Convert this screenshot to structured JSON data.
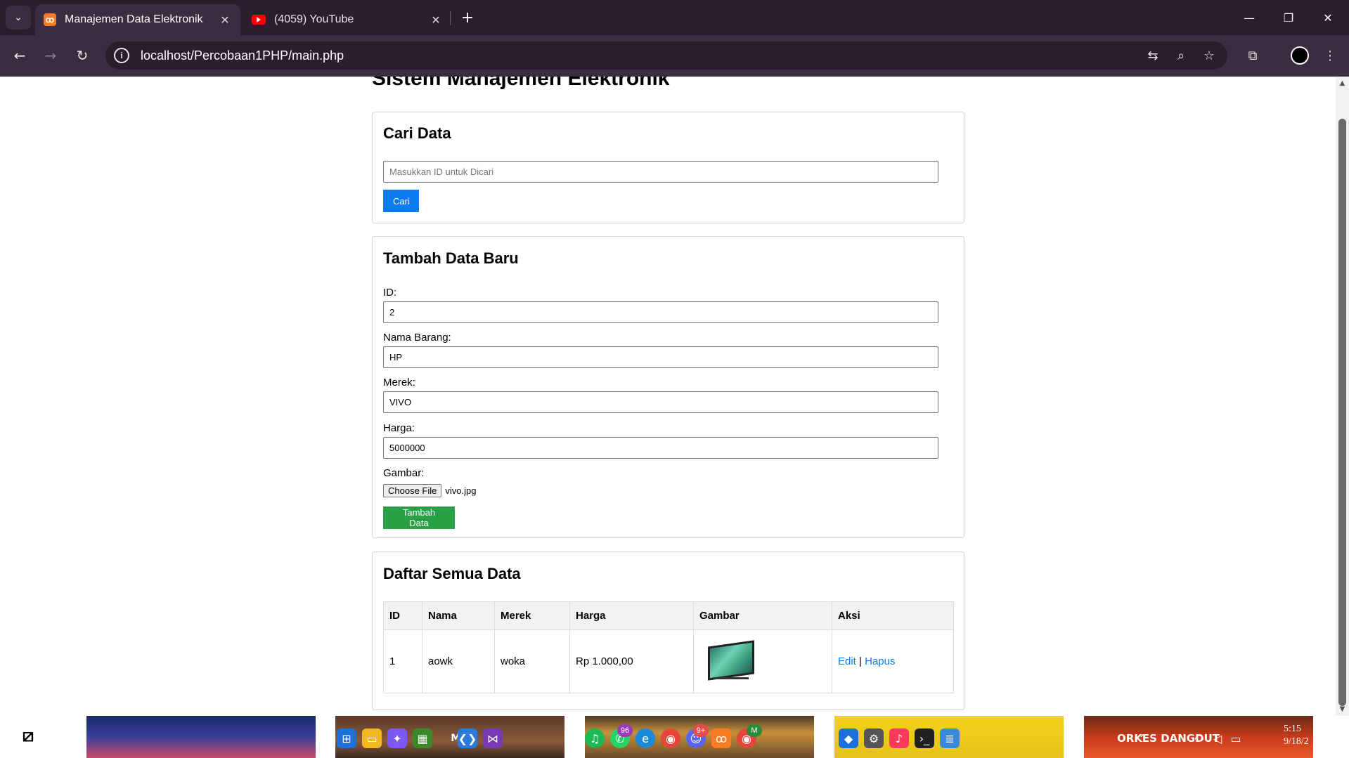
{
  "browser": {
    "tabs": [
      {
        "title": "Manajemen Data Elektronik",
        "favicon": "xampp-icon",
        "active": true
      },
      {
        "title": "(4059) YouTube",
        "favicon": "youtube-icon",
        "active": false
      }
    ],
    "url": "localhost/Percobaan1PHP/main.php"
  },
  "page": {
    "title": "Sistem Manajemen Elektronik",
    "search": {
      "heading": "Cari Data",
      "placeholder": "Masukkan ID untuk Dicari",
      "button_label": "Cari"
    },
    "add_form": {
      "heading": "Tambah Data Baru",
      "fields": {
        "id": {
          "label": "ID:",
          "value": "2"
        },
        "nama": {
          "label": "Nama Barang:",
          "value": "HP"
        },
        "merek": {
          "label": "Merek:",
          "value": "VIVO"
        },
        "harga": {
          "label": "Harga:",
          "value": "5000000"
        },
        "gambar": {
          "label": "Gambar:",
          "button": "Choose File",
          "file_name": "vivo.jpg"
        }
      },
      "submit_label": "Tambah Data"
    },
    "list": {
      "heading": "Daftar Semua Data",
      "columns": [
        "ID",
        "Nama",
        "Merek",
        "Harga",
        "Gambar",
        "Aksi"
      ],
      "rows": [
        {
          "id": "1",
          "nama": "aowk",
          "merek": "woka",
          "harga": "Rp 1.000,00",
          "gambar": "tv-image",
          "edit": "Edit",
          "separator": "|",
          "hapus": "Hapus"
        }
      ]
    }
  },
  "taskbar": {
    "badges": {
      "whatsapp": "96",
      "discord": "9+",
      "chrome_profile": "M"
    },
    "thumb_text": {
      "t2": "MT",
      "t5": "ORKES DANGDUT"
    },
    "clock": {
      "time": "5:15",
      "date": "9/18/2"
    }
  },
  "colors": {
    "primary_button": "#0a7cf0",
    "success_button": "#27a046",
    "chrome_dark": "#2a1d2e",
    "chrome_toolbar": "#3b2d3f"
  }
}
